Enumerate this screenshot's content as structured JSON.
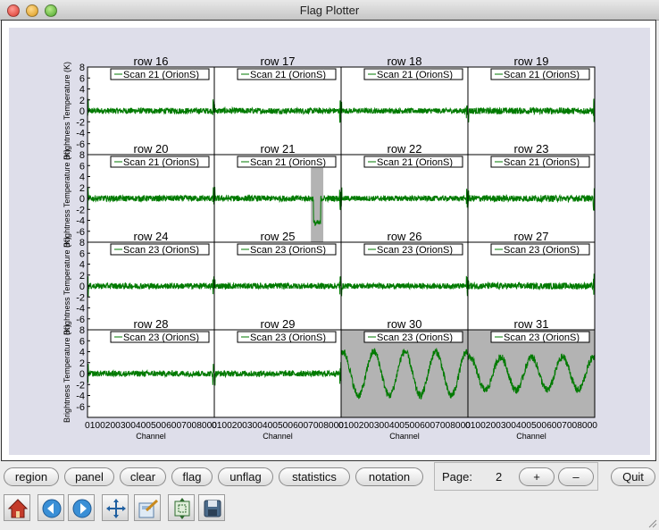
{
  "window": {
    "title": "Flag Plotter"
  },
  "chart_data": {
    "type": "line",
    "grid": "4x4",
    "ylabel": "Brightness Temperature (K)",
    "xlabel": "Channel",
    "ylim": [
      -8,
      8
    ],
    "yticks": [
      "8",
      "6",
      "4",
      "2",
      "0",
      "-2",
      "-4",
      "-6"
    ],
    "xtick_text": "01002003004005006007008000",
    "xtick_text_last": "01002003004005006007008000",
    "panels": [
      {
        "title": "row 16",
        "legend": "Scan 21 (OrionS)",
        "noise": 0.55,
        "spike_end": true
      },
      {
        "title": "row 17",
        "legend": "Scan 21 (OrionS)",
        "noise": 0.55,
        "spike_end": true
      },
      {
        "title": "row 18",
        "legend": "Scan 21 (OrionS)",
        "noise": 0.5,
        "spike_end": true
      },
      {
        "title": "row 19",
        "legend": "Scan 21 (OrionS)",
        "noise": 0.6,
        "spike_end": true
      },
      {
        "title": "row 20",
        "legend": "Scan 21 (OrionS)",
        "noise": 0.55,
        "spike_end": true
      },
      {
        "title": "row 21",
        "legend": "Scan 21 (OrionS)",
        "noise": 0.55,
        "spike_end": true,
        "flag_region": [
          780,
          880
        ],
        "dip_value": -4.5
      },
      {
        "title": "row 22",
        "legend": "Scan 21 (OrionS)",
        "noise": 0.5,
        "spike_end": true
      },
      {
        "title": "row 23",
        "legend": "Scan 21 (OrionS)",
        "noise": 0.6,
        "spike_end": true
      },
      {
        "title": "row 24",
        "legend": "Scan 23 (OrionS)",
        "noise": 0.55,
        "spike_end": true
      },
      {
        "title": "row 25",
        "legend": "Scan 23 (OrionS)",
        "noise": 0.55,
        "spike_end": true
      },
      {
        "title": "row 26",
        "legend": "Scan 23 (OrionS)",
        "noise": 0.5,
        "spike_end": true
      },
      {
        "title": "row 27",
        "legend": "Scan 23 (OrionS)",
        "noise": 0.6,
        "spike_end": true
      },
      {
        "title": "row 28",
        "legend": "Scan 23 (OrionS)",
        "noise": 0.55,
        "spike_end": true
      },
      {
        "title": "row 29",
        "legend": "Scan 23 (OrionS)",
        "noise": 0.55,
        "spike_end": true
      },
      {
        "title": "row 30",
        "legend": "Scan 23 (OrionS)",
        "noise": 0.7,
        "flagged": true,
        "sine_amp": 4,
        "sine_period": 250
      },
      {
        "title": "row 31",
        "legend": "Scan 23 (OrionS)",
        "noise": 0.7,
        "flagged": true,
        "sine_amp": 3,
        "sine_period": 250
      }
    ]
  },
  "colors": {
    "trace": "#007a00",
    "flag": "#b3b3b3",
    "canvas_bg": "#dedeea"
  },
  "buttons": {
    "region": "region",
    "panel": "panel",
    "clear": "clear",
    "flag": "flag",
    "unflag": "unflag",
    "statistics": "statistics",
    "notation": "notation",
    "quit": "Quit"
  },
  "page": {
    "label": "Page:",
    "number": "2",
    "plus": "+",
    "minus": "–"
  },
  "toolbar": [
    "home-icon",
    "back-icon",
    "forward-icon",
    "pan-icon",
    "configure-subplots-icon",
    "zoom-to-rect-icon",
    "save-icon"
  ]
}
